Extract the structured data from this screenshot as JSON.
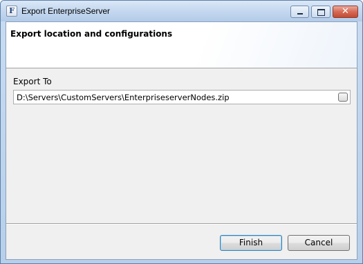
{
  "window": {
    "title": "Export EnterpriseServer",
    "app_icon_glyph": "F",
    "app_icon_name": "app-icon",
    "controls": {
      "minimize_icon": "minimize-icon",
      "maximize_icon": "maximize-icon",
      "close_glyph": "✕"
    }
  },
  "header": {
    "title": "Export location and configurations"
  },
  "form": {
    "export_to_label": "Export To",
    "export_path": "D:\\Servers\\CustomServers\\EnterpriseserverNodes.zip",
    "browse_icon": "browse-button"
  },
  "buttons": {
    "finish": "Finish",
    "cancel": "Cancel"
  },
  "colors": {
    "title_bar": "#c6d9f0",
    "close_button": "#d66a55",
    "dialog_background": "#f0f0f0",
    "default_button_border": "#3c7fb1"
  }
}
